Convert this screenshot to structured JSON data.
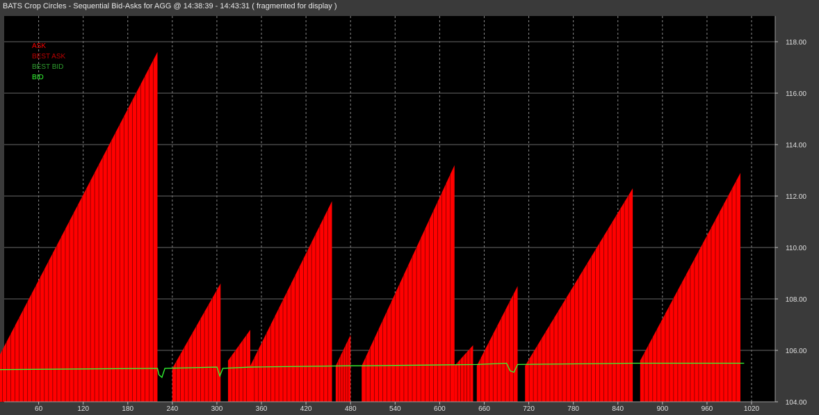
{
  "window": {
    "title": "BATS Crop Circles - Sequential Bid-Asks for  AGG  @ 14:38:39 - 14:43:31 ( fragmented for display )"
  },
  "colors": {
    "background": "#000000",
    "frame": "#3a3a3a",
    "grid": "#8a8a8a",
    "ask": "#ff0000",
    "best_ask": "#c00000",
    "best_bid": "#2ea02e",
    "bid": "#33ff33"
  },
  "chart_data": {
    "type": "area",
    "title": "BATS Crop Circles - Sequential Bid-Asks for  AGG  @ 14:38:39 - 14:43:31 ( fragmented for display )",
    "xlabel": "",
    "ylabel": "",
    "xlim": [
      0,
      1020
    ],
    "ylim": [
      104,
      118
    ],
    "grid": true,
    "legend_position": "top-left",
    "x_ticks": [
      60,
      120,
      180,
      240,
      300,
      360,
      420,
      480,
      540,
      600,
      660,
      720,
      780,
      840,
      900,
      960,
      1020
    ],
    "y_ticks": [
      "104.00",
      "106.00",
      "108.00",
      "110.00",
      "112.00",
      "114.00",
      "116.00",
      "118.00"
    ],
    "legend": [
      {
        "label": "ASK",
        "color": "#ff0000"
      },
      {
        "label": "BEST ASK",
        "color": "#c00000"
      },
      {
        "label": "BEST BID",
        "color": "#2ea02e"
      },
      {
        "label": "BID",
        "color": "#33ff33"
      }
    ],
    "series": [
      {
        "name": "ASK",
        "ramps": [
          {
            "x_start": 0,
            "x_end": 220,
            "y_start": 105.4,
            "y_end": 117.6
          },
          {
            "x_start": 240,
            "x_end": 305,
            "y_start": 105.3,
            "y_end": 108.6
          },
          {
            "x_start": 315,
            "x_end": 345,
            "y_start": 105.6,
            "y_end": 106.8
          },
          {
            "x_start": 345,
            "x_end": 455,
            "y_start": 105.4,
            "y_end": 111.8
          },
          {
            "x_start": 460,
            "x_end": 480,
            "y_start": 105.4,
            "y_end": 106.6
          },
          {
            "x_start": 495,
            "x_end": 620,
            "y_start": 105.4,
            "y_end": 113.2
          },
          {
            "x_start": 620,
            "x_end": 645,
            "y_start": 105.4,
            "y_end": 106.2
          },
          {
            "x_start": 650,
            "x_end": 705,
            "y_start": 105.4,
            "y_end": 108.5
          },
          {
            "x_start": 715,
            "x_end": 860,
            "y_start": 105.4,
            "y_end": 112.3
          },
          {
            "x_start": 870,
            "x_end": 1005,
            "y_start": 105.6,
            "y_end": 112.9
          }
        ]
      },
      {
        "name": "BID",
        "points": [
          [
            0,
            105.25
          ],
          [
            220,
            105.3
          ],
          [
            222,
            105.05
          ],
          [
            226,
            104.95
          ],
          [
            230,
            105.3
          ],
          [
            300,
            105.35
          ],
          [
            304,
            105.0
          ],
          [
            308,
            105.3
          ],
          [
            345,
            105.35
          ],
          [
            480,
            105.4
          ],
          [
            500,
            105.4
          ],
          [
            650,
            105.45
          ],
          [
            690,
            105.5
          ],
          [
            695,
            105.2
          ],
          [
            700,
            105.15
          ],
          [
            705,
            105.45
          ],
          [
            860,
            105.5
          ],
          [
            1010,
            105.5
          ]
        ]
      }
    ]
  }
}
